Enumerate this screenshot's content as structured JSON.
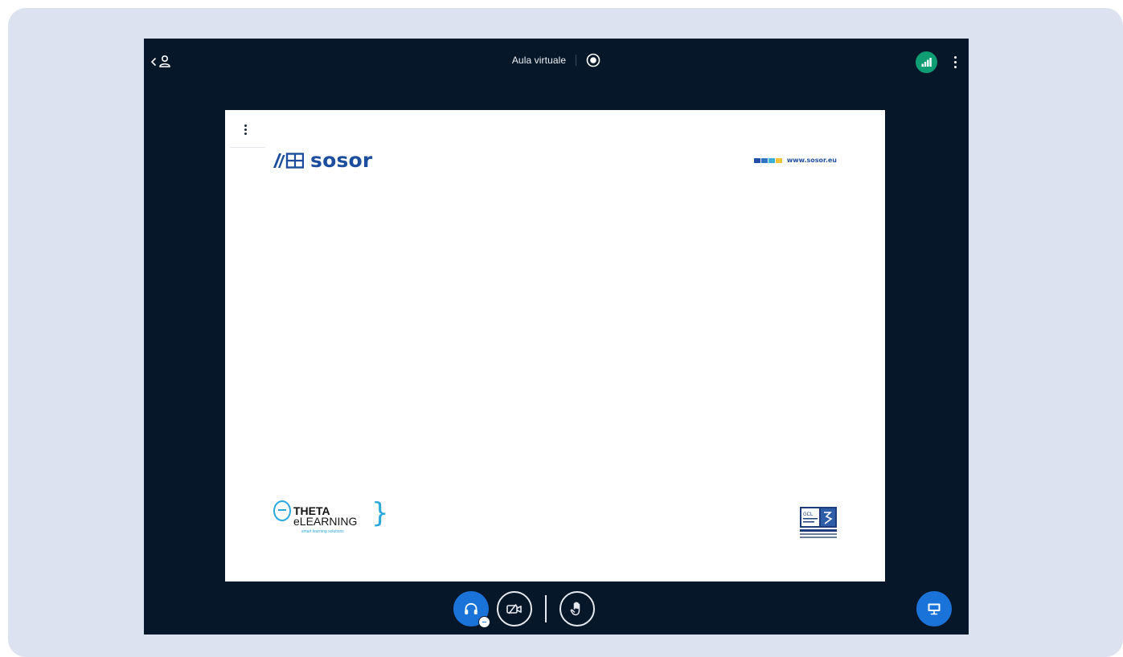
{
  "topbar": {
    "title": "Aula virtuale"
  },
  "slide": {
    "brand_name": "sosor",
    "brand_url": "www.sosor.eu",
    "brand_url_square_colors": [
      "#1f4fa8",
      "#2d74c8",
      "#3ab0d8",
      "#f2c23a"
    ],
    "partner_name": "THETA",
    "partner_product": "eLEARNING",
    "partner_tagline": "smart learning solutions",
    "cert_label": "GCL"
  },
  "icons": {
    "users_toggle": "users-toggle-icon",
    "record": "record-icon",
    "connection": "signal-bars-icon",
    "options": "kebab-menu-icon",
    "audio": "headphones-icon",
    "camera": "camera-off-icon",
    "raise_hand": "hand-icon",
    "presentation": "presentation-icon"
  },
  "colors": {
    "app_background": "#07172a",
    "accent_blue": "#1a73d9",
    "connection_green": "#0f9e74",
    "brand_blue": "#1d4e9e",
    "partner_cyan": "#2aa8dc"
  }
}
